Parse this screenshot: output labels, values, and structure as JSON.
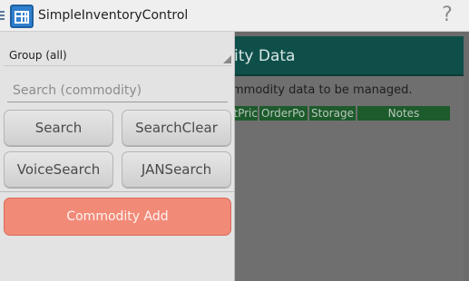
{
  "actionbar": {
    "app_title": "SimpleInventoryControl",
    "icons": {
      "menu": "menu-glyph",
      "app": "inventory-app-icon",
      "help": "help-icon"
    }
  },
  "content": {
    "header_title": "ity Data",
    "description": "mmodity data to be managed.",
    "table_columns": [
      "itPric",
      "OrderPo",
      "Storage",
      "Notes"
    ],
    "colors": {
      "header_bg": "#0f4f4a",
      "table_header_bg": "#1d5a2c"
    }
  },
  "drawer": {
    "group_select_value": "Group (all)",
    "search_placeholder": "Search (commodity)",
    "buttons": {
      "search": "Search",
      "search_clear": "SearchClear",
      "voice_search": "VoiceSearch",
      "jan_search": "JANSearch",
      "commodity_add": "Commodity Add"
    },
    "colors": {
      "add_button_bg": "#f28a78"
    }
  }
}
